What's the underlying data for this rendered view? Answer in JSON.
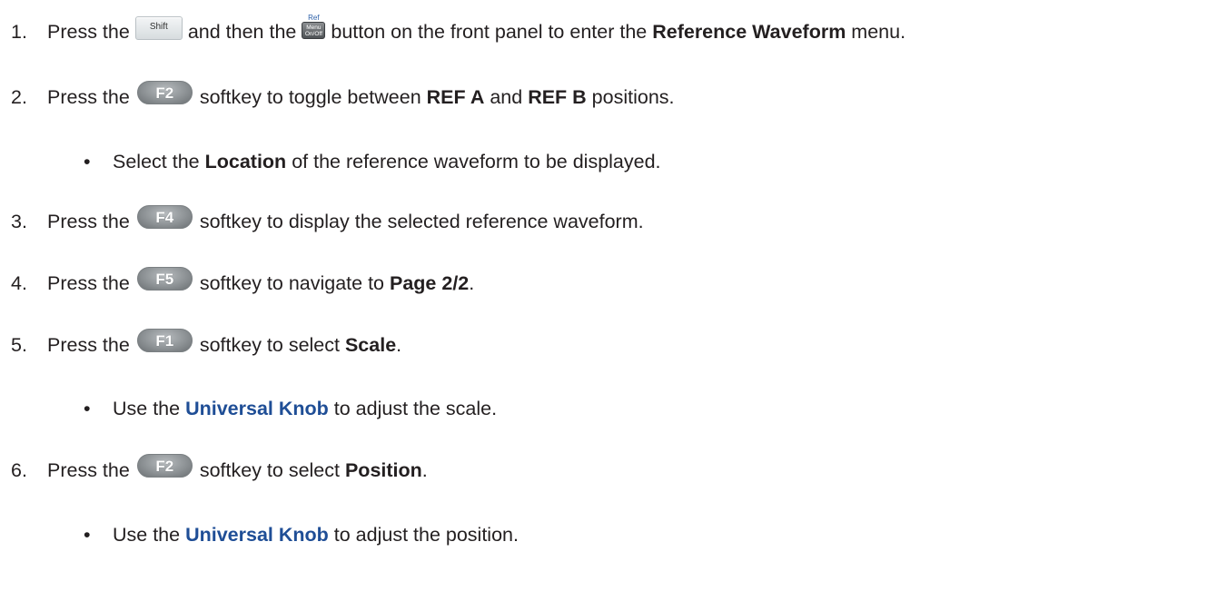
{
  "steps": [
    {
      "num": "1.",
      "t1": "Press the",
      "shift_key": "Shift",
      "t2": "and then the",
      "ref_key": {
        "top": "Ref",
        "line1": "Menu",
        "line2": "On/Off"
      },
      "t3": "button on the front panel to enter the",
      "b1": "Reference Waveform",
      "t4": "menu."
    },
    {
      "num": "2.",
      "t1": "Press the",
      "key": "F2",
      "t2": "softkey to toggle between",
      "b1": "REF A",
      "t3": "and",
      "b2": "REF B",
      "t4": "positions."
    },
    {
      "bullet": "•",
      "t1": "Select the",
      "b1": "Location",
      "t2": "of the reference waveform to be displayed."
    },
    {
      "num": "3.",
      "t1": "Press the",
      "key": "F4",
      "t2": "softkey to display the selected reference waveform."
    },
    {
      "num": "4.",
      "t1": "Press the",
      "key": "F5",
      "t2": "softkey to navigate to",
      "b1": "Page 2/2",
      "t3": "."
    },
    {
      "num": "5.",
      "t1": "Press the",
      "key": "F1",
      "t2": "softkey to select",
      "b1": "Scale",
      "t3": "."
    },
    {
      "bullet": "•",
      "t1": "Use the",
      "link": "Universal Knob",
      "t2": "to adjust the scale."
    },
    {
      "num": "6.",
      "t1": "Press the",
      "key": "F2",
      "t2": "softkey to select",
      "b1": "Position",
      "t3": "."
    },
    {
      "bullet": "•",
      "t1": "Use the",
      "link": "Universal Knob",
      "t2": "to adjust the position."
    }
  ],
  "colors": {
    "text": "#231f20",
    "link": "#1f4e96",
    "softkey": "#8e9396"
  },
  "icons": {
    "shift_key": "shift-key-icon",
    "ref_key": "ref-menu-key-icon",
    "softkey": "softkey-icon"
  }
}
